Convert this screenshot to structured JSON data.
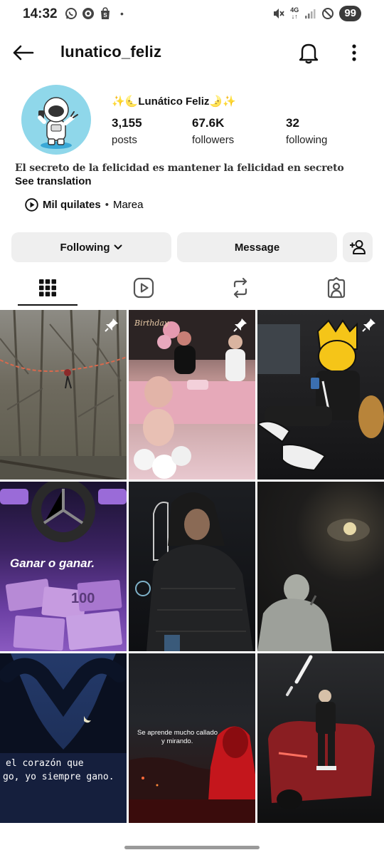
{
  "status_bar": {
    "time": "14:32",
    "left_icons": [
      "whatsapp-icon",
      "target-app-icon",
      "shop-icon"
    ],
    "dot": "•",
    "network_top": "4G",
    "network_bottom": "↓↑",
    "battery": "99"
  },
  "header": {
    "username": "lunatico_feliz"
  },
  "profile": {
    "display_name": "✨🌜Lunático Feliz🌛✨",
    "stats": [
      {
        "value": "3,155",
        "label": "posts"
      },
      {
        "value": "67.6K",
        "label": "followers"
      },
      {
        "value": "32",
        "label": "following"
      }
    ],
    "bio": "El secreto de la felicidad es mantener la felicidad en secreto",
    "see_translation": "See translation",
    "music": {
      "title": "Mil quilates",
      "separator": "•",
      "artist": "Marea"
    }
  },
  "actions": {
    "following_label": "Following",
    "message_label": "Message"
  },
  "tabs": [
    "grid-icon",
    "reels-icon",
    "reposts-icon",
    "tagged-icon"
  ],
  "grid_posts": [
    {
      "name": "post-forest-slackline",
      "pinned": true
    },
    {
      "name": "post-birthday-party",
      "pinned": true,
      "text": "Birthday"
    },
    {
      "name": "post-bart-car",
      "pinned": true
    },
    {
      "name": "post-ganar-o-ganar",
      "pinned": false,
      "text": "Ganar o ganar."
    },
    {
      "name": "post-hooded-man",
      "pinned": false
    },
    {
      "name": "post-night-moon",
      "pinned": false
    },
    {
      "name": "post-heart-hands",
      "pinned": false,
      "text_lines": [
        "el corazón que",
        "go, yo siempre gano."
      ]
    },
    {
      "name": "post-red-hoodie",
      "pinned": false,
      "text_lines": [
        "Se aprende mucho callado",
        "y mirando."
      ]
    },
    {
      "name": "post-red-car",
      "pinned": false
    }
  ]
}
